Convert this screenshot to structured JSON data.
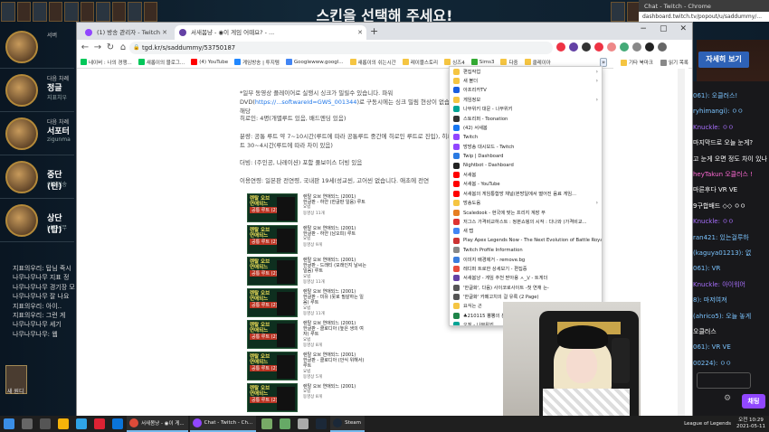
{
  "game": {
    "banner": "스킨을 선택해 주세요!",
    "slots": [
      {
        "role": "서버",
        "pos": "",
        "name": ""
      },
      {
        "role": "다음 차례",
        "pos": "정글",
        "name": "지표치우"
      },
      {
        "role": "다음 차례",
        "pos": "서포터",
        "name": "zigunma"
      },
      {
        "role": "",
        "pos": "중단 (턴)",
        "name": "이미건송"
      },
      {
        "role": "",
        "pos": "상단 (탑)",
        "name": "나무나무"
      }
    ],
    "chat_lines": [
      "지표의우리: 탑님 죽시",
      "나무나무나무 지표 정",
      "나무나무나무 경기장 모",
      "나무나무나무 잘 나요",
      "지표의우리: 아이..",
      "지표의우리: 그런 게",
      "나무나무나무 세기",
      "나무나무나무: 웹"
    ],
    "skin_label": "새 원디",
    "right_button": "자세히 보기"
  },
  "browser": {
    "tabs": [
      {
        "label": "(1) 방송 관리자 - Twitch",
        "color": "#9146ff"
      },
      {
        "label": "서새봄냥 - ◉이 게임 어때요? - ...",
        "color": "#6441a5"
      }
    ],
    "window": {
      "minimize": "−",
      "maximize": "▢",
      "close": "✕"
    },
    "nav": {
      "back": "←",
      "forward": "→",
      "reload": "↻",
      "home": "⌂"
    },
    "url": "tgd.kr/s/saddummy/53750187",
    "bookmarks": [
      "네이버 : 나의 경쟁...",
      "새롭이의 블로그...",
      "(4) YouTube",
      "게임방송 | 투지템",
      "Googlewww.googl...",
      "새롭이의 쉬는시간",
      "레이블스토리",
      "싱즈4",
      "Sims3",
      "다중",
      "클레이아"
    ],
    "bookmarks_right": [
      "기타 북마크",
      "읽기 목록"
    ],
    "overflow": "»"
  },
  "article": {
    "p1": "*일부 동영상 플레이어로 실행시 싱크가 밀릴수 있습니다. 파워DVD(",
    "p1_link": "https://...softwareId=GWS_001344",
    "p1b": ")로 구동시에는 싱크 밀림 현상이 없습니다. 해당",
    "p2": "히로인: 4명(개별루트 있음, 배드엔딩 있음)",
    "p3": "분량: 공통 루트 약 7~10시간(루트에 따라 공통루트 중간에 히로인 루트로 진입), 히로인 루트 30~4시간(루트에 따라 차이 있음)",
    "p4": "더빙: (주인공, 나레이션) 포함 풀보이스 더빙 있음",
    "p5": "이용연령: 일본판 전연령, 국내판 19세(성교씬, 고어씬 없습니다. 애초에 전연",
    "games": [
      {
        "t1": "렌탈 오브",
        "t2": "연애되느",
        "sub": "공통 루트 (2)",
        "title": "렌탈 오브 연애되느 (2001)",
        "route": "한글판 - 하얀 (한글판 일음) 루트",
        "meta1": "요법",
        "meta2": "동영상 11개"
      },
      {
        "t1": "렌탈 오브",
        "t2": "연애되느",
        "sub": "공통 루트 (2)",
        "title": "렌탈 오브 연애되느 (2001)",
        "route": "한글판 - 하얀 (남오피) 루트",
        "meta1": "요법",
        "meta2": "동영상 9개"
      },
      {
        "t1": "렌탈 오브",
        "t2": "연애되느",
        "sub": "공통 루트 (2)",
        "title": "렌탈 오브 연애되느 (2001)",
        "route": "한글판 - 드래티 (모래인지 날씨는 일음) 루트",
        "meta1": "요법",
        "meta2": "동영상 11개"
      },
      {
        "t1": "렌탈 오브",
        "t2": "연애되느",
        "sub": "공통 루트 (2)",
        "title": "렌탈 오브 연애되느 (2001)",
        "route": "한글판 - 미유 (못로 필살하는 일음) 루트",
        "meta1": "요법",
        "meta2": "동영상 11개"
      },
      {
        "t1": "렌탈 오브",
        "t2": "연애되느",
        "sub": "공통 루트 (2)",
        "title": "렌탈 오브 연애되느 (2001)",
        "route": "한글판 - 클로디아 (높은 생의 여자) 루트",
        "meta1": "요법",
        "meta2": "동영상 8개"
      },
      {
        "t1": "렌탈 오브",
        "t2": "연애되느",
        "sub": "공통 루트 (2)",
        "title": "렌탈 오브 연애되느 (2001)",
        "route": "한글판 - 클로디아 (안식 위해서) 루트",
        "meta1": "요법",
        "meta2": "동영상 5개"
      },
      {
        "t1": "렌탈 오브",
        "t2": "연애되느",
        "sub": "공통 루트 (2)",
        "title": "렌탈 오브 연애되느 (2001)",
        "route": "",
        "meta1": "요법",
        "meta2": "동영상 8개"
      }
    ]
  },
  "dropdown": [
    {
      "label": "편집작업",
      "icon": "folder",
      "sub": true
    },
    {
      "label": "새 볼더",
      "icon": "folder",
      "sub": true
    },
    {
      "label": "아프리카TV",
      "icon": "afreeca"
    },
    {
      "label": "게임정보",
      "icon": "folder",
      "sub": true
    },
    {
      "label": "나무위키 대문 - 나무위키",
      "icon": "namu"
    },
    {
      "label": "스토리퍼 - Toonation",
      "icon": "toon"
    },
    {
      "label": "(42) 서새봄",
      "icon": "fb"
    },
    {
      "label": "Twitch",
      "icon": "twitch"
    },
    {
      "label": "방방송 대시보드 - Twitch",
      "icon": "twitch"
    },
    {
      "label": "Twip | Dashboard",
      "icon": "twip"
    },
    {
      "label": "Nightbot - Dashboard",
      "icon": "night"
    },
    {
      "label": "서새봄",
      "icon": "yt"
    },
    {
      "label": "서새봄 - YouTube",
      "icon": "yt"
    },
    {
      "label": "서새봄의 게임통합방 채널(본방일에서 떨어진 음료 게임...",
      "icon": "yt"
    },
    {
      "label": "방송도움",
      "icon": "folder",
      "sub": true
    },
    {
      "label": "Scaledook - 현국에 맞는 프리지 계장 부",
      "icon": "scale"
    },
    {
      "label": "저그스 가격비교하스트 : 정본쇼핑의 시작 : 다나와 (가격비교...",
      "icon": "dana"
    },
    {
      "label": "새 탭",
      "icon": "chrome"
    },
    {
      "label": "Play Apex Legends Now - The Next Evolution of Battle Roya...",
      "icon": "apex"
    },
    {
      "label": "Twitch Profile Information",
      "icon": "globe"
    },
    {
      "label": "이미지 배경제거 - remove.bg",
      "icon": "rbg"
    },
    {
      "label": "레디퍼 트로한 상세보기 - 편집중",
      "icon": "red"
    },
    {
      "label": "서새봄냥 - 게임 추천 받아용 ㅅ_)/ - 트게더",
      "icon": "tgd"
    },
    {
      "label": "'한글화', 다음) 사이코로사이트 -첫 연재 는-",
      "icon": "t"
    },
    {
      "label": "'한글화' 카페고치의 걸 유록 (2 Page)",
      "icon": "t"
    },
    {
      "label": "요식는 곤",
      "icon": "folder"
    },
    {
      "label": "♣210115 뽕뽕의 분...",
      "icon": "club"
    },
    {
      "label": "오징 - 나무위키",
      "icon": "namu"
    }
  ],
  "chat": {
    "window_title": "Chat - Twitch - Chrome",
    "url": "dashboard.twitch.tv/popout/u/saddummy/...",
    "lines": [
      {
        "user": "",
        "text": "061): 오클러스!",
        "color": "#7bc4ff"
      },
      {
        "user": "",
        "text": "ryhimangi): ㅇㅇ",
        "color": "#7bc4ff"
      },
      {
        "user": "",
        "text": "Knuckle: ㅇㅇ",
        "color": "#a970ff"
      },
      {
        "user": "",
        "text": "마지막드로 오늘 눈게?",
        "color": "#ffffff"
      },
      {
        "user": "",
        "text": "고 눈게 오면 정도 차이 있나",
        "color": "#ffffff"
      },
      {
        "user": "",
        "text": "heyTakun 오클러스 !",
        "color": "#ff6ad5"
      },
      {
        "user": "",
        "text": "마른후다 VR VE",
        "color": "#ffffff"
      },
      {
        "user": "",
        "text": "9구합배드 ◇◇ ㅇㅇ",
        "color": "#ffffff"
      },
      {
        "user": "",
        "text": "Knuckle: ㅇㅇ",
        "color": "#a970ff"
      },
      {
        "user": "",
        "text": "ran421: 있는걸루하",
        "color": "#7bc4ff"
      },
      {
        "user": "",
        "text": "(kaguya01213): 없",
        "color": "#7bc4ff"
      },
      {
        "user": "",
        "text": "061): VR",
        "color": "#7bc4ff"
      },
      {
        "user": "",
        "text": "Knuckle: 아이워어",
        "color": "#a970ff"
      },
      {
        "user": "",
        "text": "8): 마저여져",
        "color": "#7bc4ff"
      },
      {
        "user": "",
        "text": "(ahrico5): 오늘 놓게",
        "color": "#7bc4ff"
      },
      {
        "user": "",
        "text": "오클러스",
        "color": "#ffffff"
      },
      {
        "user": "",
        "text": "061): VR VE",
        "color": "#7bc4ff"
      },
      {
        "user": "",
        "text": "00224): ㅇㅇ",
        "color": "#7bc4ff"
      }
    ],
    "send_label": "채팅",
    "gear": "⚙"
  },
  "taskbar": {
    "tasks": [
      {
        "label": "서새봄냥 - ◉이 게...",
        "color": "#dd4b39"
      },
      {
        "label": "Chat - Twitch - Ch...",
        "color": "#9146ff"
      },
      {
        "label": "Steam",
        "color": "#1b2838"
      }
    ],
    "lol_task": "League of Legends",
    "time": "오전 10:29",
    "date": "2021-05-11"
  }
}
